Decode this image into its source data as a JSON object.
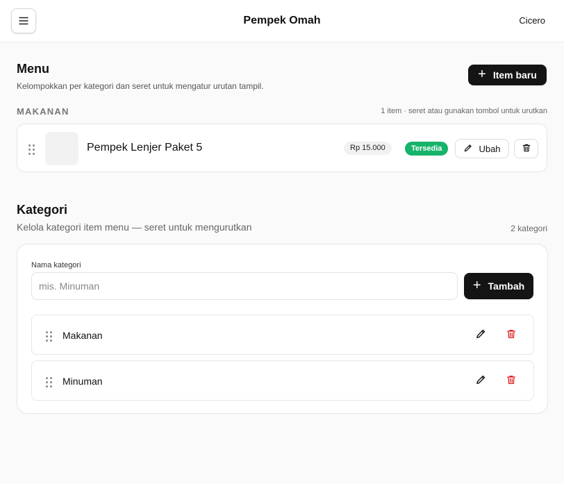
{
  "header": {
    "app_title": "Pempek Omah",
    "user_name": "Cicero"
  },
  "menu": {
    "title": "Menu",
    "subtitle": "Kelompokkan per kategori dan seret untuk mengatur urutan tampil.",
    "new_item_label": "Item baru",
    "groups": [
      {
        "label": "MAKANAN",
        "hint": "1 item · seret atau gunakan tombol untuk urutkan",
        "items": [
          {
            "name": "Pempek Lenjer Paket 5",
            "price": "Rp 15.000",
            "status": "Tersedia",
            "edit_label": "Ubah"
          }
        ]
      }
    ]
  },
  "categories": {
    "title": "Kategori",
    "subtitle": "Kelola kategori item menu — seret untuk mengurutkan",
    "count_label": "2 kategori",
    "field_label": "Nama kategori",
    "input_placeholder": "mis. Minuman",
    "input_value": "",
    "add_label": "Tambah",
    "items": [
      {
        "name": "Makanan"
      },
      {
        "name": "Minuman"
      }
    ]
  },
  "colors": {
    "accent_dark": "#141414",
    "status_green": "#16b36a",
    "danger_red": "#e02424"
  },
  "icons": {
    "menu": "hamburger-icon",
    "plus": "plus-icon",
    "drag": "drag-handle-icon",
    "edit": "pencil-icon",
    "delete": "trash-icon"
  }
}
